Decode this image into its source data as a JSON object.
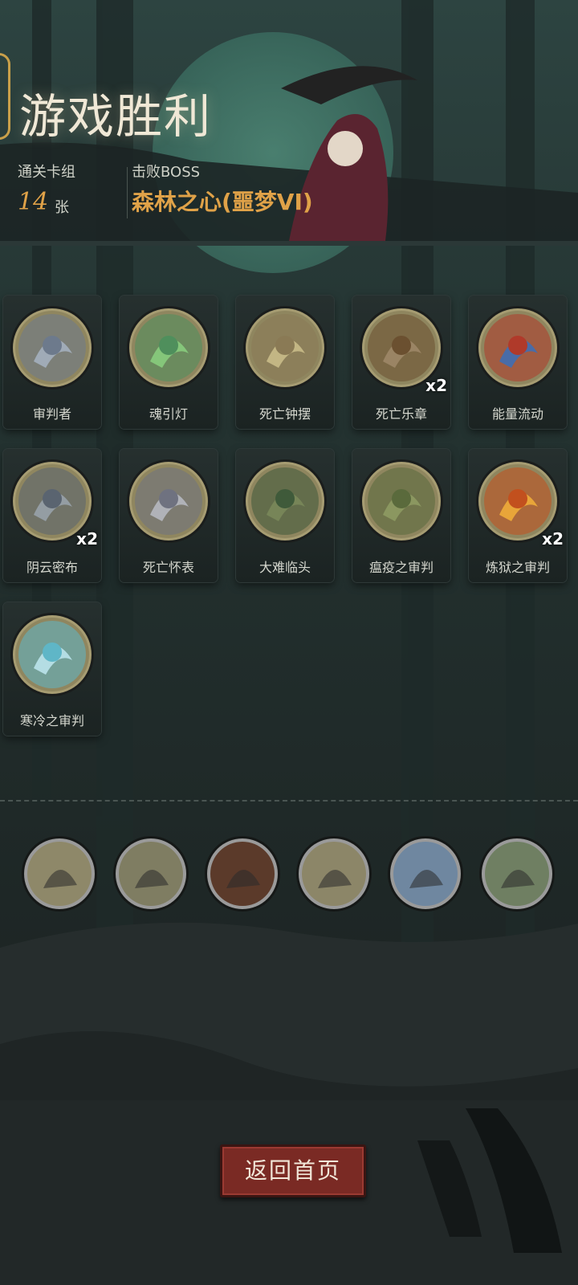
{
  "header": {
    "title": "游戏胜利",
    "deck_label": "通关卡组",
    "deck_count": "14",
    "deck_unit": "张",
    "boss_label": "击败BOSS",
    "boss_name": "森林之心(噩梦VI)"
  },
  "cards": [
    {
      "name": "审判者",
      "icon": "scythe-icon",
      "count": ""
    },
    {
      "name": "魂引灯",
      "icon": "lantern-icon",
      "count": ""
    },
    {
      "name": "死亡钟摆",
      "icon": "pendulum-icon",
      "count": ""
    },
    {
      "name": "死亡乐章",
      "icon": "chest-icon",
      "count": "x2"
    },
    {
      "name": "能量流动",
      "icon": "energy-flow-icon",
      "count": ""
    },
    {
      "name": "阴云密布",
      "icon": "storm-cloud-icon",
      "count": "x2"
    },
    {
      "name": "死亡怀表",
      "icon": "pocket-watch-icon",
      "count": ""
    },
    {
      "name": "大难临头",
      "icon": "doom-icon",
      "count": ""
    },
    {
      "name": "瘟疫之审判",
      "icon": "plague-icon",
      "count": ""
    },
    {
      "name": "炼狱之审判",
      "icon": "inferno-icon",
      "count": "x2"
    },
    {
      "name": "寒冷之审判",
      "icon": "ice-icon",
      "count": ""
    }
  ],
  "relics": [
    {
      "icon": "cuckoo-clock-icon"
    },
    {
      "icon": "gravedigger-icon"
    },
    {
      "icon": "framed-relic-icon"
    },
    {
      "icon": "cross-icon"
    },
    {
      "icon": "dagger-icon"
    },
    {
      "icon": "zombie-icon"
    }
  ],
  "button": {
    "label": "返回首页"
  }
}
